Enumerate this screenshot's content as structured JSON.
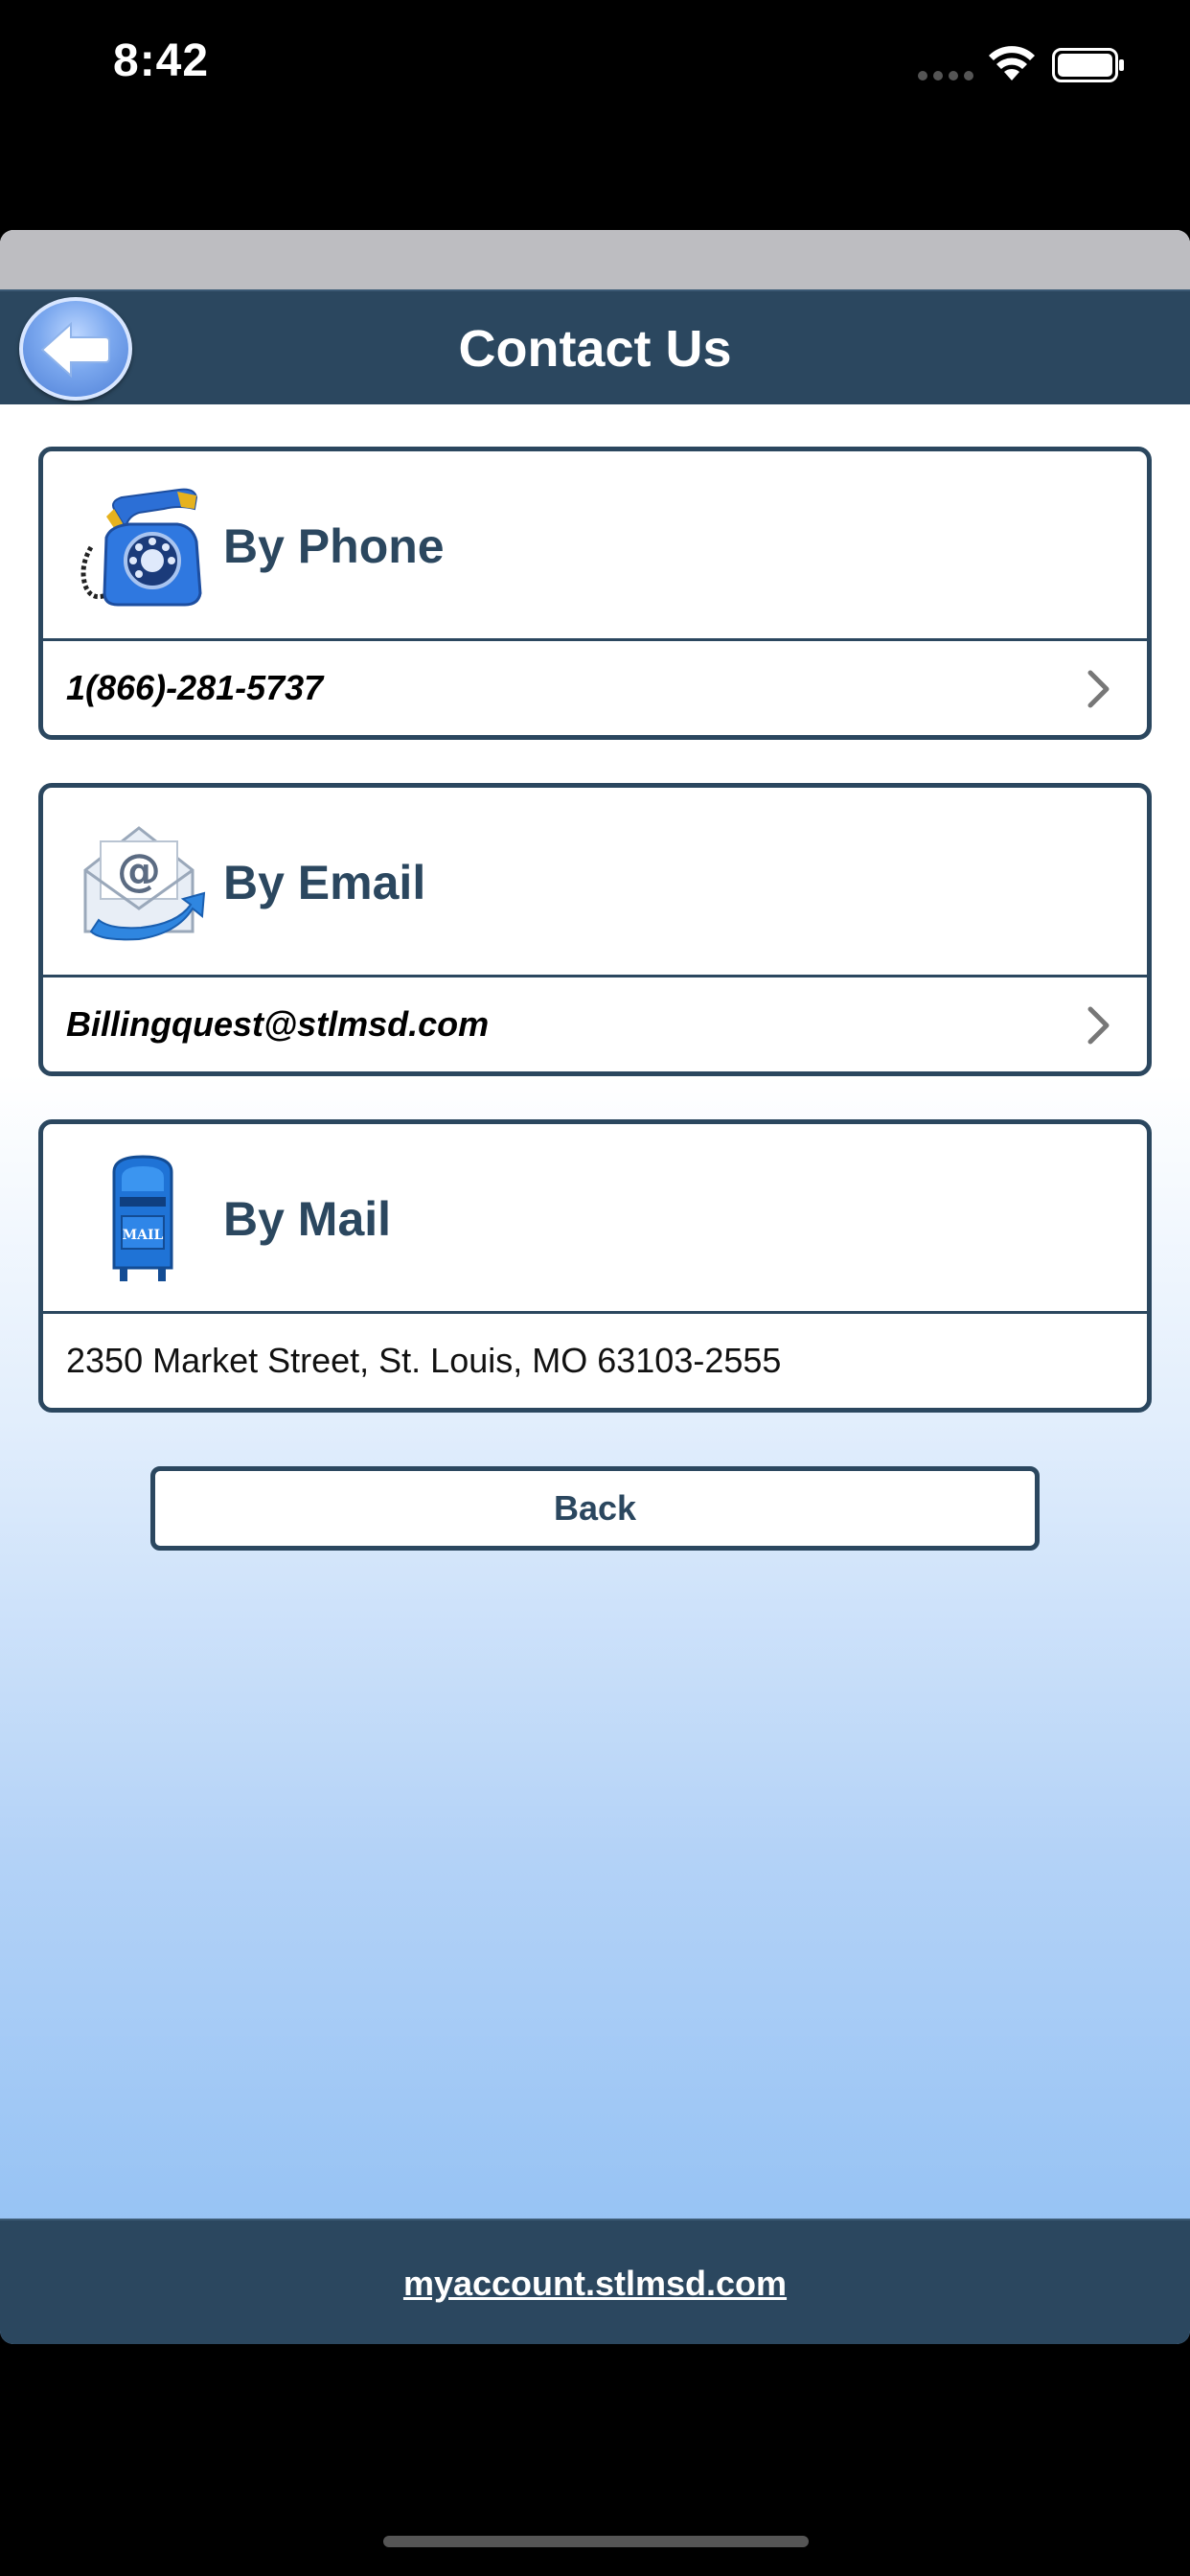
{
  "status_bar": {
    "time": "8:42"
  },
  "header": {
    "title": "Contact Us",
    "back_icon": "back-arrow-icon"
  },
  "cards": [
    {
      "title": "By Phone",
      "icon": "telephone-icon",
      "value": "1(866)-281-5737",
      "has_chevron": true
    },
    {
      "title": "By Email",
      "icon": "email-envelope-icon",
      "value": "Billingquest@stlmsd.com",
      "has_chevron": true
    },
    {
      "title": "By Mail",
      "icon": "mailbox-icon",
      "value": "2350 Market Street, St. Louis, MO 63103-2555",
      "mailbox_text": "MAIL",
      "has_chevron": false
    }
  ],
  "back_button": {
    "label": "Back"
  },
  "footer": {
    "link": "myaccount.stlmsd.com"
  },
  "colors": {
    "navy": "#2b475f",
    "sky": "#97c3f4"
  }
}
